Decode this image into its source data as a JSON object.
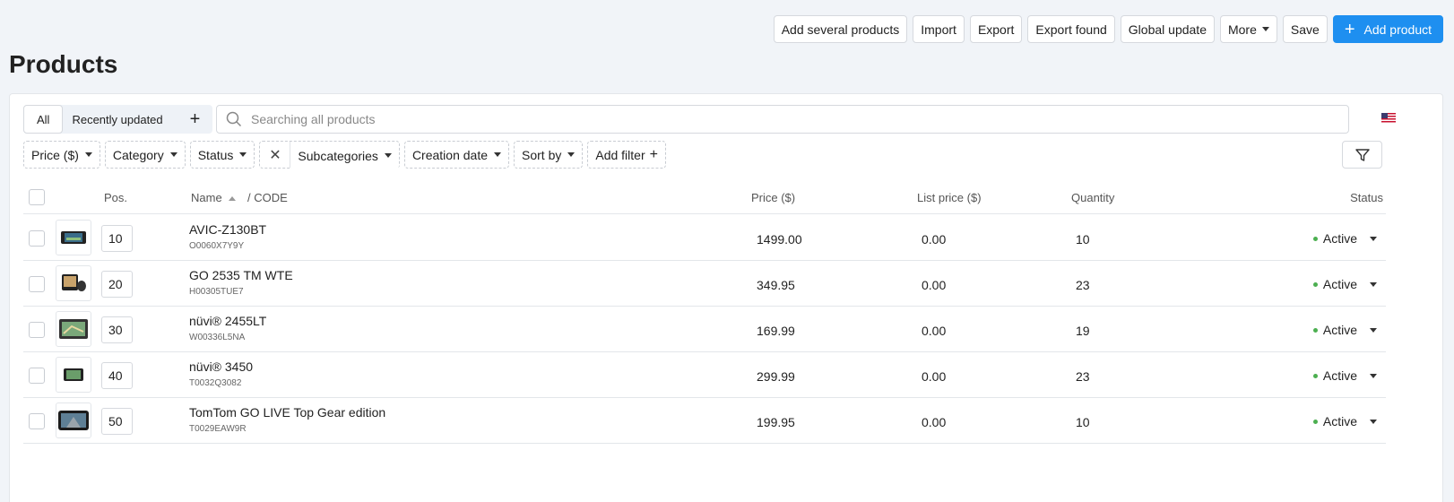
{
  "toolbar": {
    "add_several": "Add several products",
    "import": "Import",
    "export": "Export",
    "export_found": "Export found",
    "global_update": "Global update",
    "more": "More",
    "save": "Save",
    "add_product": "Add product"
  },
  "page_title": "Products",
  "tabs": {
    "all": "All",
    "recent": "Recently updated",
    "add": "+"
  },
  "search": {
    "placeholder": "Searching all products"
  },
  "filters": {
    "price": "Price ($)",
    "category": "Category",
    "status": "Status",
    "clear": "✕",
    "subcategories": "Subcategories",
    "creation_date": "Creation date",
    "sort_by": "Sort by",
    "add_filter": "Add filter"
  },
  "table": {
    "headers": {
      "pos": "Pos.",
      "name": "Name",
      "code": "/  CODE",
      "price": "Price ($)",
      "list_price": "List price ($)",
      "quantity": "Quantity",
      "status": "Status"
    },
    "rows": [
      {
        "pos": "10",
        "name": "AVIC-Z130BT",
        "code": "O0060X7Y9Y",
        "price": "1499.00",
        "list_price": "0.00",
        "quantity": "10",
        "status": "Active"
      },
      {
        "pos": "20",
        "name": "GO 2535 TM WTE",
        "code": "H00305TUE7",
        "price": "349.95",
        "list_price": "0.00",
        "quantity": "23",
        "status": "Active"
      },
      {
        "pos": "30",
        "name": "nüvi® 2455LT",
        "code": "W00336L5NA",
        "price": "169.99",
        "list_price": "0.00",
        "quantity": "19",
        "status": "Active"
      },
      {
        "pos": "40",
        "name": "nüvi® 3450",
        "code": "T0032Q3082",
        "price": "299.99",
        "list_price": "0.00",
        "quantity": "23",
        "status": "Active"
      },
      {
        "pos": "50",
        "name": "TomTom GO LIVE Top Gear edition",
        "code": "T0029EAW9R",
        "price": "199.95",
        "list_price": "0.00",
        "quantity": "10",
        "status": "Active"
      }
    ]
  },
  "colors": {
    "primary": "#1e8ff0",
    "active_dot": "#4caf50"
  }
}
